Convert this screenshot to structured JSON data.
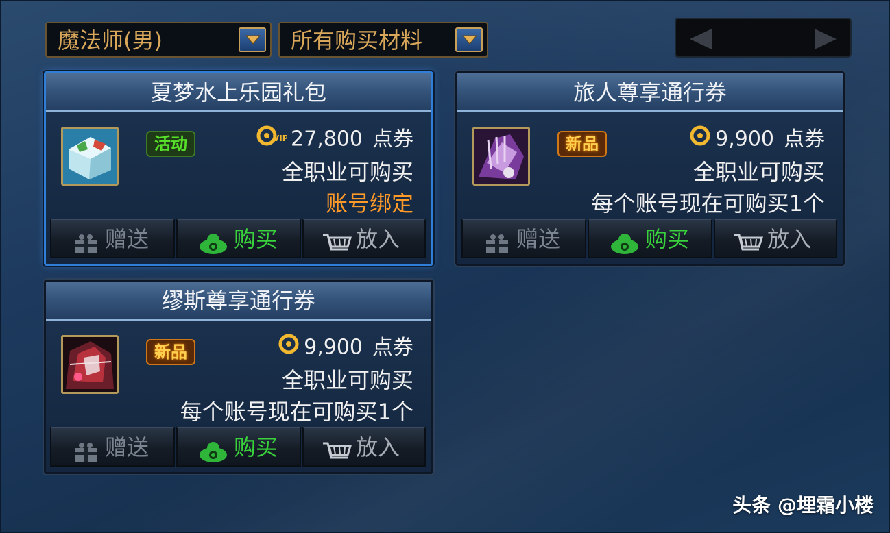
{
  "filters": {
    "class_select": {
      "value": "魔法师(男)"
    },
    "material_select": {
      "value": "所有购买材料"
    }
  },
  "pager": {
    "prev_icon": "triangle-left-icon",
    "next_icon": "triangle-right-icon"
  },
  "colors": {
    "accent_gold": "#d9a75a",
    "selected_border": "#2f7fd8",
    "buy_green": "#39d23c",
    "bind_orange": "#ff9a28"
  },
  "cards": [
    {
      "title": "夏梦水上乐园礼包",
      "badge": "活动",
      "badge_kind": "activity",
      "currency_icon": "vip-coupon-icon",
      "price": "27,800",
      "unit": "点券",
      "line1": "全职业可购买",
      "line2": "账号绑定",
      "selected": true
    },
    {
      "title": "旅人尊享通行券",
      "badge": "新品",
      "badge_kind": "new",
      "currency_icon": "coupon-icon",
      "price": "9,900",
      "unit": "点券",
      "line1": "全职业可购买",
      "line2": "每个账号现在可购买1个",
      "selected": false
    },
    {
      "title": "缪斯尊享通行券",
      "badge": "新品",
      "badge_kind": "new",
      "currency_icon": "coupon-icon",
      "price": "9,900",
      "unit": "点券",
      "line1": "全职业可购买",
      "line2": "每个账号现在可购买1个",
      "selected": false
    }
  ],
  "actions": {
    "gift": "赠送",
    "buy": "购买",
    "cart": "放入"
  },
  "watermark": "头条 @埋霜小楼"
}
